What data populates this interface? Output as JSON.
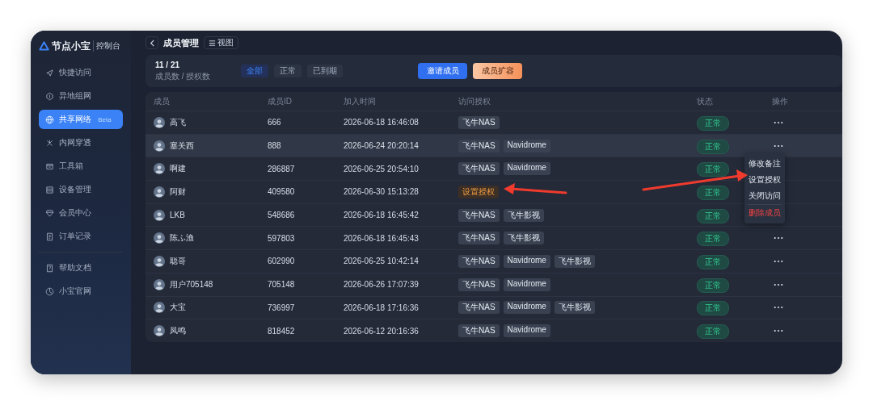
{
  "brand": {
    "name": "节点小宝",
    "subtitle": "控制台"
  },
  "sidebar": {
    "items": [
      {
        "label": "快捷访问",
        "selected": false
      },
      {
        "label": "异地组网",
        "selected": false
      },
      {
        "label": "共享网络",
        "badge": "Beta",
        "selected": true
      },
      {
        "label": "内网穿透",
        "selected": false
      },
      {
        "label": "工具箱",
        "selected": false
      },
      {
        "label": "设备管理",
        "selected": false
      },
      {
        "label": "会员中心",
        "selected": false
      },
      {
        "label": "订单记录",
        "selected": false
      }
    ],
    "bottom_items": [
      {
        "label": "帮助文档",
        "selected": false
      },
      {
        "label": "小宝官网",
        "selected": false
      }
    ]
  },
  "header": {
    "title": "成员管理",
    "view_button": "视图"
  },
  "summary": {
    "count": "11 / 21",
    "caption": "成员数 / 授权数",
    "filters": [
      {
        "label": "全部",
        "selected": true
      },
      {
        "label": "正常",
        "selected": false
      },
      {
        "label": "已到期",
        "selected": false
      }
    ],
    "invite_button": "邀请成员",
    "expand_button": "成员扩容"
  },
  "table": {
    "columns": [
      "成员",
      "成员ID",
      "加入时间",
      "访问授权",
      "状态",
      "操作"
    ],
    "rows": [
      {
        "name": "高飞",
        "id": "666",
        "joined": "2026-06-18 16:46:08",
        "access": [
          {
            "label": "飞牛NAS",
            "kind": "tag"
          }
        ],
        "status": "正常",
        "selected": false
      },
      {
        "name": "塞关西",
        "id": "888",
        "joined": "2026-06-24 20:20:14",
        "access": [
          {
            "label": "飞牛NAS",
            "kind": "tag"
          },
          {
            "label": "Navidrome",
            "kind": "tag"
          }
        ],
        "status": "正常",
        "selected": true
      },
      {
        "name": "啊建",
        "id": "286887",
        "joined": "2026-06-25 20:54:10",
        "access": [
          {
            "label": "飞牛NAS",
            "kind": "tag"
          },
          {
            "label": "Navidrome",
            "kind": "tag"
          }
        ],
        "status": "正常",
        "selected": false
      },
      {
        "name": "阿财",
        "id": "409580",
        "joined": "2026-06-30 15:13:28",
        "access": [
          {
            "label": "设置授权",
            "kind": "action"
          }
        ],
        "status": "正常",
        "selected": false
      },
      {
        "name": "LKB",
        "id": "548686",
        "joined": "2026-06-18 16:45:42",
        "access": [
          {
            "label": "飞牛NAS",
            "kind": "tag"
          },
          {
            "label": "飞牛影视",
            "kind": "tag"
          }
        ],
        "status": "正常",
        "selected": false
      },
      {
        "name": "陈ふ渔",
        "id": "597803",
        "joined": "2026-06-18 16:45:43",
        "access": [
          {
            "label": "飞牛NAS",
            "kind": "tag"
          },
          {
            "label": "飞牛影视",
            "kind": "tag"
          }
        ],
        "status": "正常",
        "selected": false
      },
      {
        "name": "聪哥",
        "id": "602990",
        "joined": "2026-06-25 10:42:14",
        "access": [
          {
            "label": "飞牛NAS",
            "kind": "tag"
          },
          {
            "label": "Navidrome",
            "kind": "tag"
          },
          {
            "label": "飞牛影视",
            "kind": "tag"
          }
        ],
        "status": "正常",
        "selected": false
      },
      {
        "name": "用户705148",
        "id": "705148",
        "joined": "2026-06-26 17:07:39",
        "access": [
          {
            "label": "飞牛NAS",
            "kind": "tag"
          },
          {
            "label": "Navidrome",
            "kind": "tag"
          }
        ],
        "status": "正常",
        "selected": false
      },
      {
        "name": "大宝",
        "id": "736997",
        "joined": "2026-06-18 17:16:36",
        "access": [
          {
            "label": "飞牛NAS",
            "kind": "tag"
          },
          {
            "label": "Navidrome",
            "kind": "tag"
          },
          {
            "label": "飞牛影视",
            "kind": "tag"
          }
        ],
        "status": "正常",
        "selected": false
      },
      {
        "name": "凤鸣",
        "id": "818452",
        "joined": "2026-06-12 20:16:36",
        "access": [
          {
            "label": "飞牛NAS",
            "kind": "tag"
          },
          {
            "label": "Navidrome",
            "kind": "tag"
          }
        ],
        "status": "正常",
        "selected": false
      }
    ]
  },
  "row_menu": {
    "items": [
      {
        "label": "修改备注",
        "kind": "normal"
      },
      {
        "label": "设置授权",
        "kind": "normal"
      },
      {
        "label": "关闭访问",
        "kind": "normal"
      },
      {
        "label": "删除成员",
        "kind": "danger"
      }
    ]
  }
}
